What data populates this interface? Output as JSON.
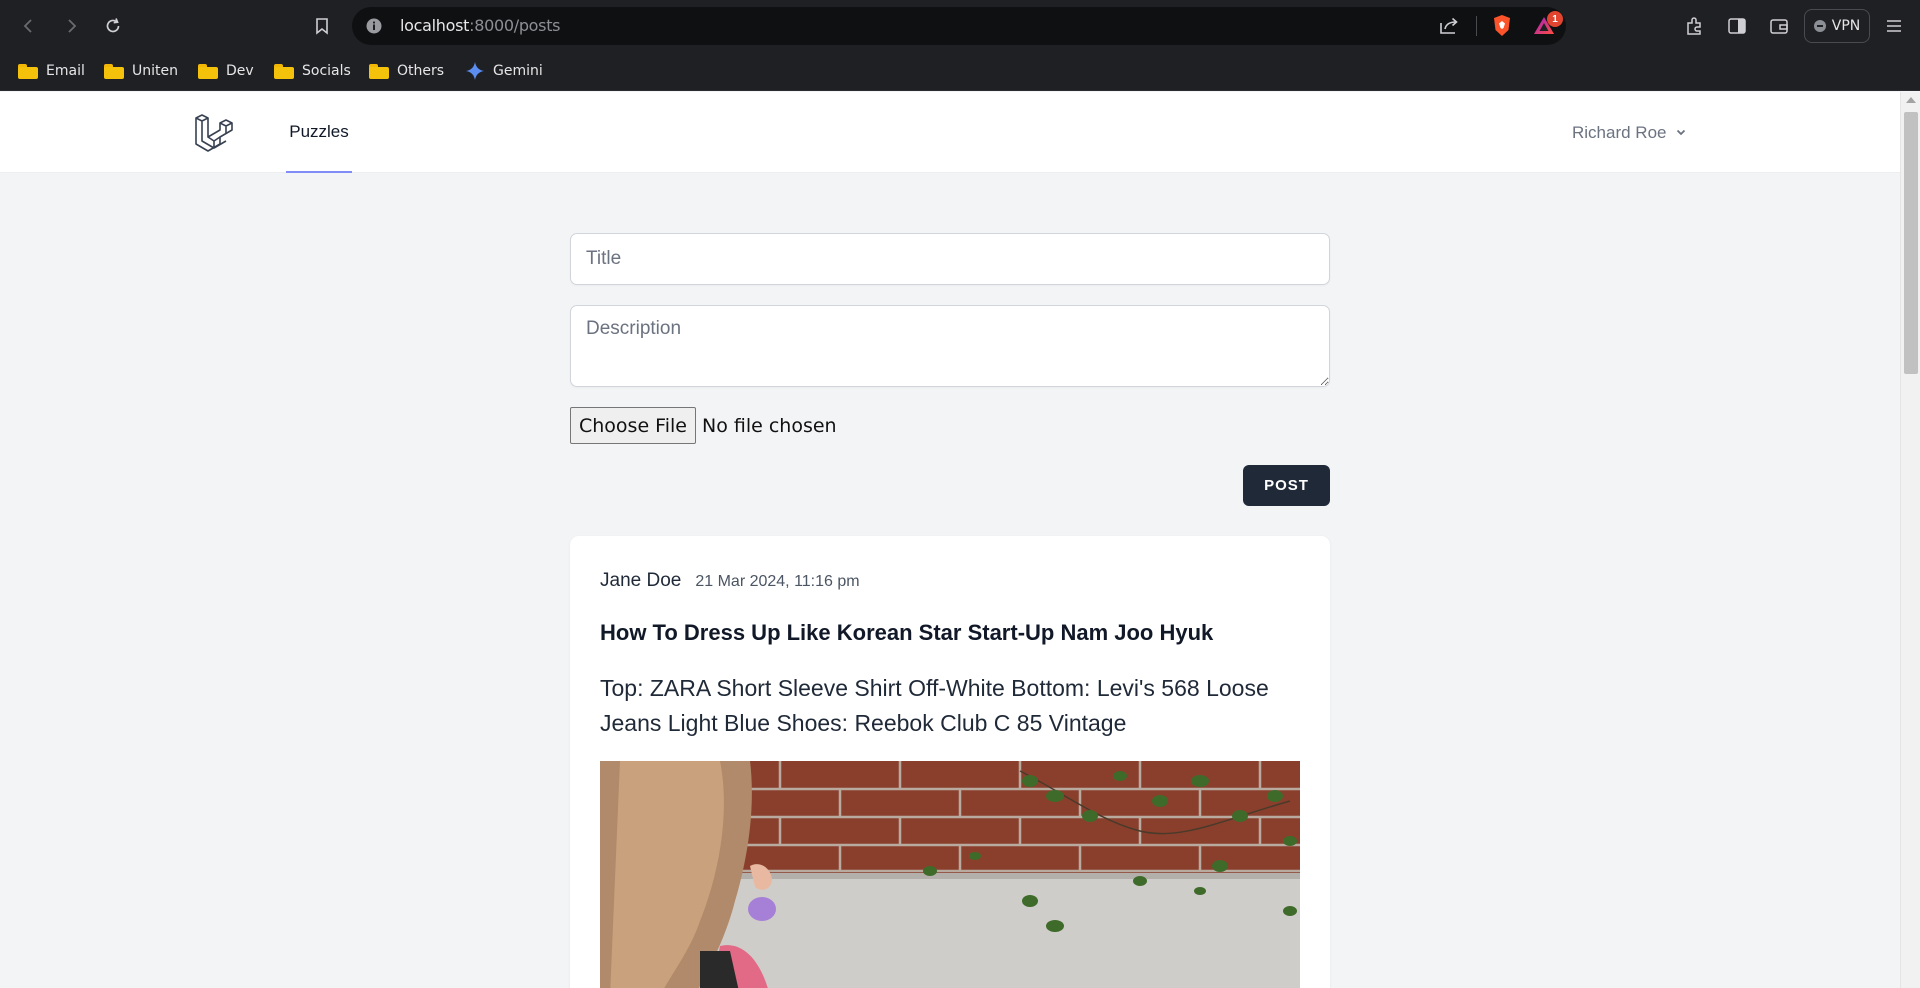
{
  "browser": {
    "url_host": "localhost",
    "url_path": ":8000/posts",
    "notification_count": "1",
    "vpn_label": "VPN",
    "bookmarks": [
      {
        "label": "Email",
        "icon": "folder-icon"
      },
      {
        "label": "Uniten",
        "icon": "folder-icon"
      },
      {
        "label": "Dev",
        "icon": "folder-icon"
      },
      {
        "label": "Socials",
        "icon": "folder-icon"
      },
      {
        "label": "Others",
        "icon": "folder-icon"
      },
      {
        "label": "Gemini",
        "icon": "sparkle-icon"
      }
    ]
  },
  "nav": {
    "links": [
      {
        "label": "Puzzles",
        "active": true
      }
    ],
    "user_name": "Richard Roe"
  },
  "form": {
    "title_placeholder": "Title",
    "description_placeholder": "Description",
    "file_button": "Choose File",
    "file_status": "No file chosen",
    "submit_label": "POST"
  },
  "posts": [
    {
      "author": "Jane Doe",
      "date": "21 Mar 2024, 11:16 pm",
      "title": "How To Dress Up Like Korean Star Start-Up Nam Joo Hyuk",
      "body": "Top: ZARA Short Sleeve Shirt Off-White Bottom: Levi's 568 Loose Jeans Light Blue Shoes: Reebok Club C 85 Vintage"
    }
  ],
  "colors": {
    "accent": "#818cf8",
    "button_dark": "#1f2937",
    "page_bg": "#f3f4f6"
  }
}
